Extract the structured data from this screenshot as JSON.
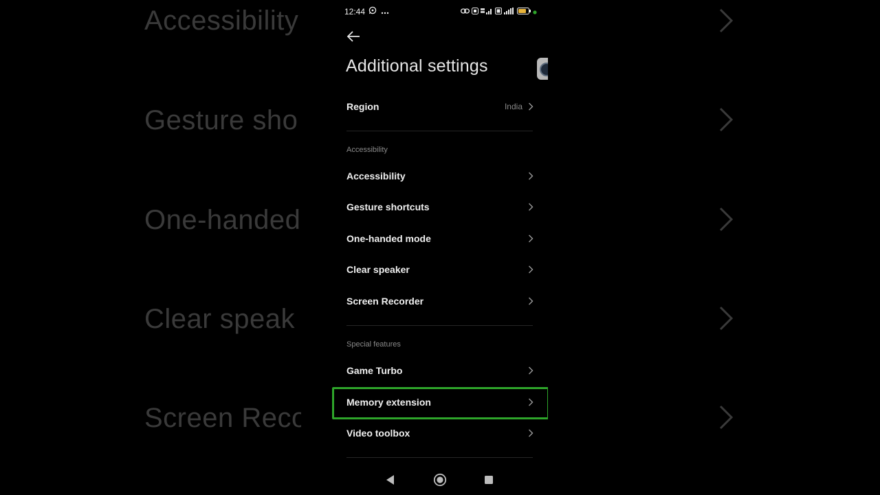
{
  "status_bar": {
    "time": "12:44",
    "left_icons": [
      "whatsapp-icon",
      "more-dots-icon"
    ],
    "right_icons": [
      "link-icon",
      "data-saver-icon",
      "signal-4g-icon",
      "volte-icon",
      "signal-icon",
      "battery-icon",
      "privacy-dot"
    ],
    "battery_level": "28",
    "privacy_dot_color": "#2ea52a"
  },
  "header": {
    "title": "Additional settings"
  },
  "rows": {
    "region": {
      "label": "Region",
      "value": "India"
    }
  },
  "sections": {
    "accessibility": {
      "header": "Accessibility",
      "items": [
        {
          "label": "Accessibility"
        },
        {
          "label": "Gesture shortcuts"
        },
        {
          "label": "One-handed mode"
        },
        {
          "label": "Clear speaker"
        },
        {
          "label": "Screen Recorder"
        }
      ]
    },
    "special": {
      "header": "Special features",
      "items": [
        {
          "label": "Game Turbo"
        },
        {
          "label": "Memory extension"
        },
        {
          "label": "Video toolbox"
        }
      ]
    }
  },
  "highlighted_item": "Memory extension",
  "highlight_color": "#2ea52a",
  "background_echo": {
    "labels": [
      "Accessibility",
      "Gesture sho",
      "One-handed",
      "Clear speak",
      "Screen Reco"
    ]
  }
}
